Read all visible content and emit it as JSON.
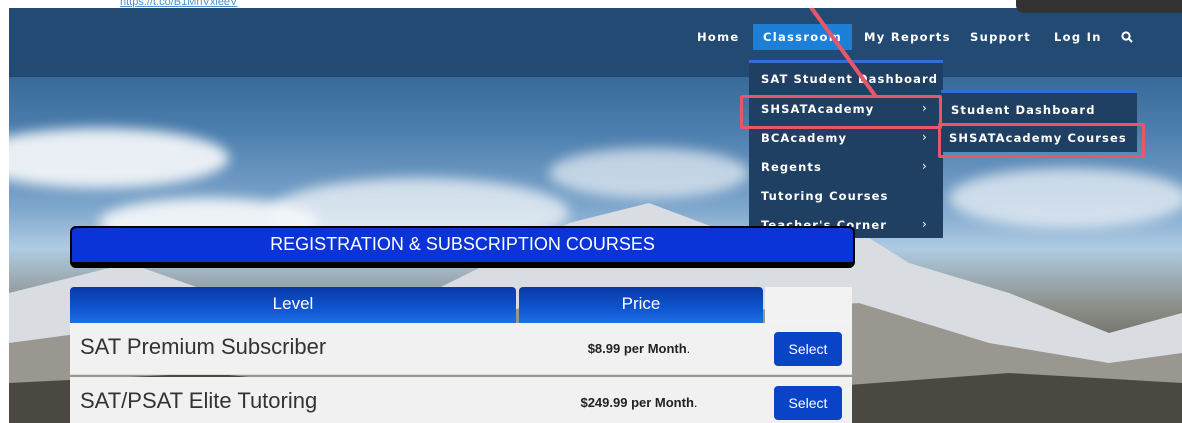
{
  "top_link": "https://t.co/B1MnVxleeV",
  "nav": {
    "home": "Home",
    "classroom": "Classroom",
    "my_reports": "My Reports",
    "support": "Support",
    "login": "Log In"
  },
  "dropdown": {
    "items": [
      "SAT Student Dashboard",
      "SHSATAcademy",
      "BCAcademy",
      "Regents",
      "Tutoring Courses",
      "Teacher's Corner"
    ],
    "submenu": [
      "Student Dashboard",
      "SHSATAcademy Courses"
    ]
  },
  "banner": "REGISTRATION & SUBSCRIPTION COURSES",
  "table": {
    "col_level": "Level",
    "col_price": "Price",
    "rows": [
      {
        "name": "SAT Premium Subscriber",
        "price": "$8.99 per Month",
        "suffix": ".",
        "button": "Select"
      },
      {
        "name": "SAT/PSAT Elite Tutoring",
        "price": "$249.99 per Month",
        "suffix": ".",
        "button": "Select"
      }
    ]
  },
  "colors": {
    "nav_bg": "#234a73",
    "active_tab": "#1d7fd6",
    "highlight": "#e9566a",
    "banner": "#0a33d8",
    "select_button": "#0a44c6"
  }
}
